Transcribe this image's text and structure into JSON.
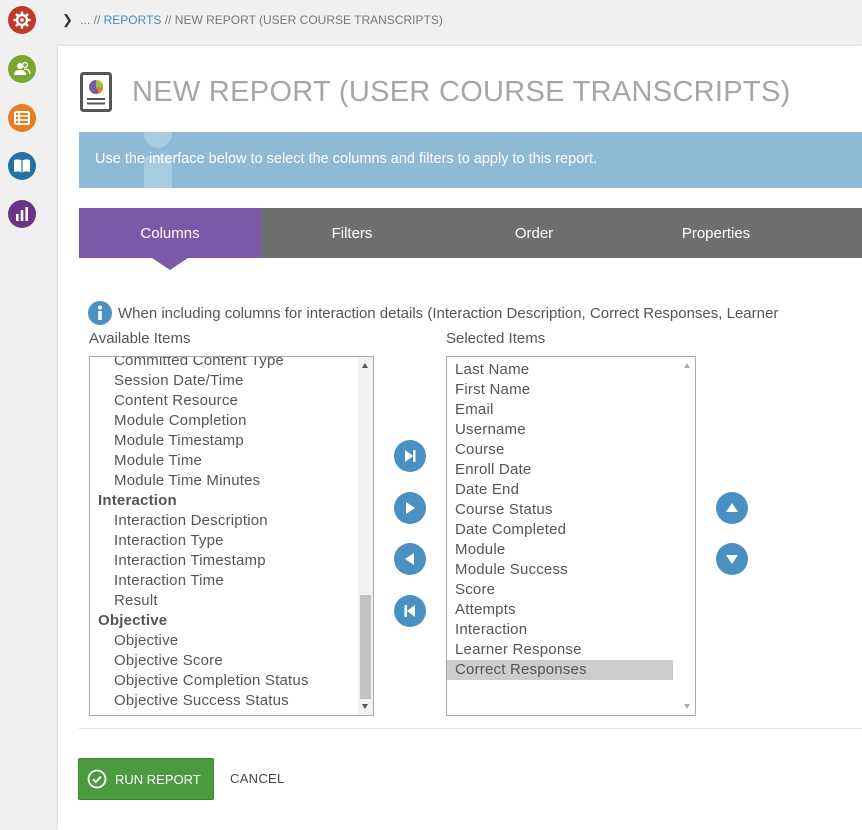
{
  "rail": {
    "items": [
      {
        "icon": "settings-gear-icon",
        "color": "#c0392b"
      },
      {
        "icon": "users-icon",
        "color": "#7aa82e"
      },
      {
        "icon": "catalog-icon",
        "color": "#e67e22"
      },
      {
        "icon": "book-icon",
        "color": "#2471a3"
      },
      {
        "icon": "reports-chart-icon",
        "color": "#6c3483"
      }
    ]
  },
  "breadcrumb": {
    "ellipsis": "...",
    "sep1": "//",
    "reports": "REPORTS",
    "sep2": "//",
    "current": "NEW REPORT (USER COURSE TRANSCRIPTS)"
  },
  "page": {
    "title": "NEW REPORT (USER COURSE TRANSCRIPTS)",
    "banner": "Use the interface below to select the columns and filters to apply to this report."
  },
  "tabs": [
    "Columns",
    "Filters",
    "Order",
    "Properties"
  ],
  "active_tab": "Columns",
  "note": "When including columns for interaction details (Interaction Description, Correct Responses, Learner",
  "available": {
    "label": "Available Items",
    "items": [
      {
        "text": "Committed Content Type",
        "group": false
      },
      {
        "text": "Session Date/Time",
        "group": false
      },
      {
        "text": "Content Resource",
        "group": false
      },
      {
        "text": "Module Completion",
        "group": false
      },
      {
        "text": "Module Timestamp",
        "group": false
      },
      {
        "text": "Module Time",
        "group": false
      },
      {
        "text": "Module Time Minutes",
        "group": false
      },
      {
        "text": "Interaction",
        "group": true
      },
      {
        "text": "Interaction Description",
        "group": false
      },
      {
        "text": "Interaction Type",
        "group": false
      },
      {
        "text": "Interaction Timestamp",
        "group": false
      },
      {
        "text": "Interaction Time",
        "group": false
      },
      {
        "text": "Result",
        "group": false
      },
      {
        "text": "Objective",
        "group": true
      },
      {
        "text": "Objective",
        "group": false
      },
      {
        "text": "Objective Score",
        "group": false
      },
      {
        "text": "Objective Completion Status",
        "group": false
      },
      {
        "text": "Objective Success Status",
        "group": false
      }
    ],
    "scroll_position": 0.88
  },
  "selected": {
    "label": "Selected Items",
    "items": [
      "Last Name",
      "First Name",
      "Email",
      "Username",
      "Course",
      "Enroll Date",
      "Date End",
      "Course Status",
      "Date Completed",
      "Module",
      "Module Success",
      "Score",
      "Attempts",
      "Interaction",
      "Learner Response",
      "Correct Responses"
    ],
    "highlighted": "Correct Responses"
  },
  "transfer_buttons": [
    "move-all-right-icon",
    "move-right-icon",
    "move-left-icon",
    "move-all-left-icon"
  ],
  "order_buttons": [
    "move-up-icon",
    "move-down-icon"
  ],
  "actions": {
    "run": "RUN REPORT",
    "cancel": "CANCEL"
  },
  "colors": {
    "tab_active": "#7a59a8",
    "tab_bar": "#6f6f6f",
    "banner": "#8dbad4",
    "round_button": "#4a90c2",
    "run_button": "#4c9a3f"
  }
}
